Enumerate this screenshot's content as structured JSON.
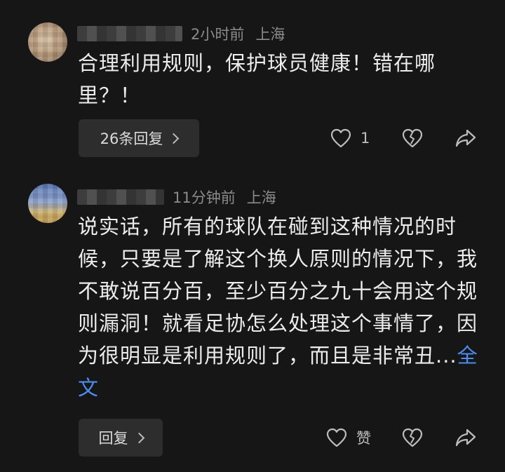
{
  "comments": [
    {
      "time": "2小时前",
      "location": "上海",
      "name_partial": "是",
      "text": "合理利用规则，保护球员健康！错在哪里？！",
      "reply_button_label": "26条回复",
      "like_count": "1",
      "full_text_link": ""
    },
    {
      "time": "11分钟前",
      "location": "上海",
      "name_partial": "嘎",
      "text": "说实话，所有的球队在碰到这种情况的时候，只要是了解这个换人原则的情况下，我不敢说百分百，至少百分之九十会用这个规则漏洞！就看足协怎么处理这个事情了，因为很明显是利用规则了，而且是非常丑...",
      "full_text_link": "全文",
      "reply_button_label": "回复",
      "like_count": "赞"
    }
  ],
  "icons": {
    "like": "heart-outline-icon",
    "dislike": "broken-heart-icon",
    "share": "share-arrow-icon"
  },
  "colors": {
    "background": "#161616",
    "text": "#ececec",
    "meta": "#8b8b8b",
    "link": "#4a8ff0",
    "button_bg": "#2d2d2d"
  }
}
